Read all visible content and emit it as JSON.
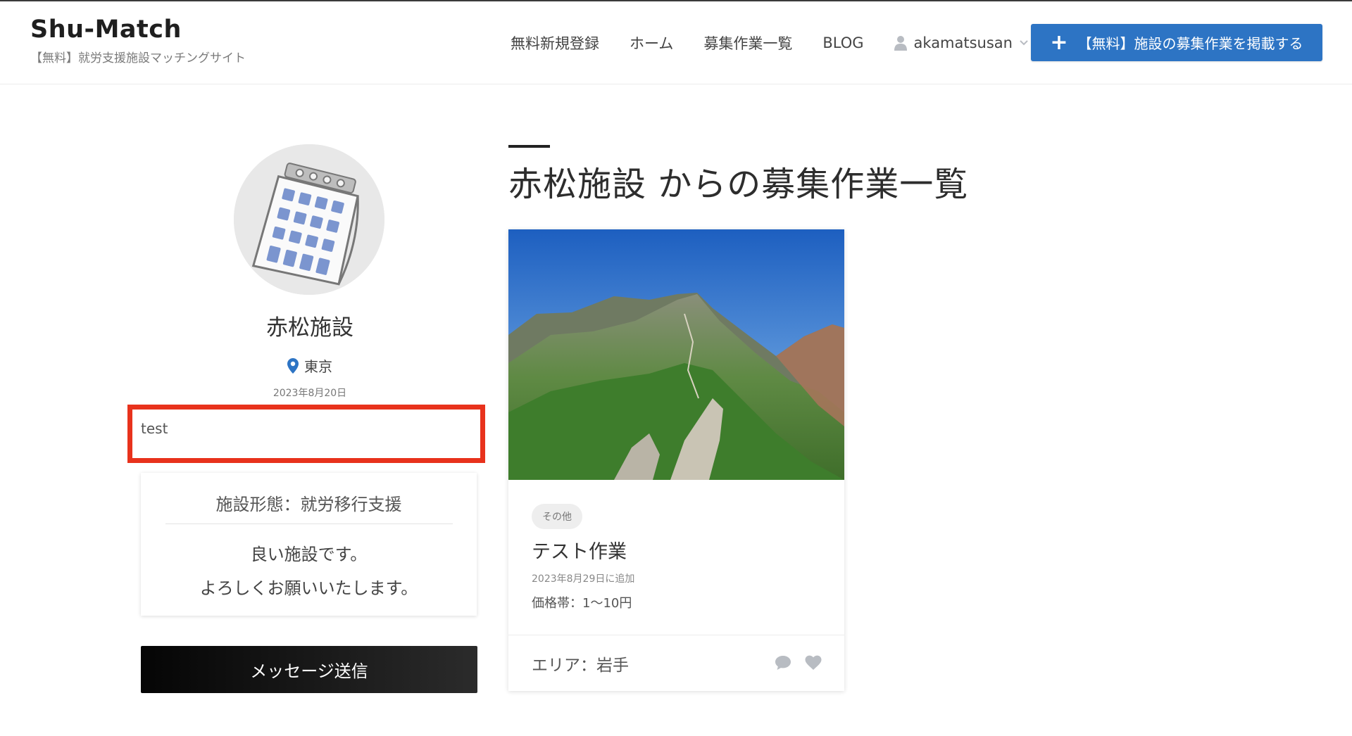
{
  "header": {
    "brand_title": "Shu-Match",
    "brand_subtitle": "【無料】就労支援施設マッチングサイト",
    "nav": [
      {
        "label": "無料新規登録"
      },
      {
        "label": "ホーム"
      },
      {
        "label": "募集作業一覧"
      },
      {
        "label": "BLOG"
      }
    ],
    "user_name": "akamatsusan",
    "post_button_label": "【無料】施設の募集作業を掲載する",
    "post_button_icon": "+"
  },
  "profile": {
    "avatar_icon": "calendar-illustration",
    "name": "赤松施設",
    "location": "東京",
    "registered_date": "2023年8月20日",
    "intro": "test",
    "facility_type": "施設形態：就労移行支援",
    "description_lines": [
      "良い施設です。",
      "よろしくお願いいたします。"
    ],
    "message_button_label": "メッセージ送信"
  },
  "main": {
    "section_title": "赤松施設 からの募集作業一覧",
    "jobs": [
      {
        "image_icon": "mountain-photo",
        "category": "その他",
        "title": "テスト作業",
        "added_date": "2023年8月29日に追加",
        "price": "価格帯：1〜10円",
        "area": "エリア：岩手"
      }
    ]
  },
  "colors": {
    "accent": "#2d74c4",
    "highlight": "#e8321c",
    "pin": "#2d74c4",
    "icon_gray": "#b8bcc2"
  }
}
